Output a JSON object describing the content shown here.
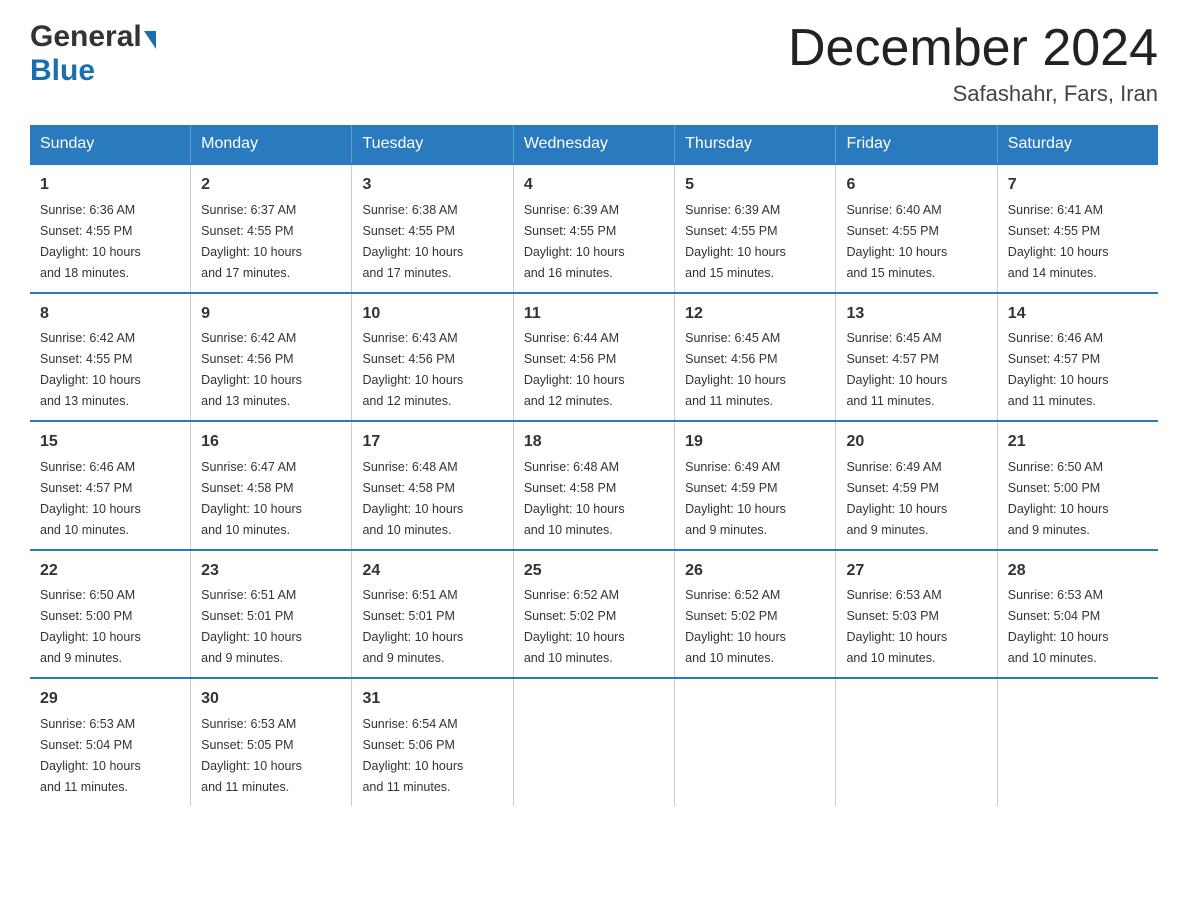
{
  "header": {
    "logo_general": "General",
    "logo_blue": "Blue",
    "month_title": "December 2024",
    "location": "Safashahr, Fars, Iran"
  },
  "weekdays": [
    "Sunday",
    "Monday",
    "Tuesday",
    "Wednesday",
    "Thursday",
    "Friday",
    "Saturday"
  ],
  "weeks": [
    [
      {
        "day": "1",
        "sunrise": "6:36 AM",
        "sunset": "4:55 PM",
        "daylight": "10 hours and 18 minutes."
      },
      {
        "day": "2",
        "sunrise": "6:37 AM",
        "sunset": "4:55 PM",
        "daylight": "10 hours and 17 minutes."
      },
      {
        "day": "3",
        "sunrise": "6:38 AM",
        "sunset": "4:55 PM",
        "daylight": "10 hours and 17 minutes."
      },
      {
        "day": "4",
        "sunrise": "6:39 AM",
        "sunset": "4:55 PM",
        "daylight": "10 hours and 16 minutes."
      },
      {
        "day": "5",
        "sunrise": "6:39 AM",
        "sunset": "4:55 PM",
        "daylight": "10 hours and 15 minutes."
      },
      {
        "day": "6",
        "sunrise": "6:40 AM",
        "sunset": "4:55 PM",
        "daylight": "10 hours and 15 minutes."
      },
      {
        "day": "7",
        "sunrise": "6:41 AM",
        "sunset": "4:55 PM",
        "daylight": "10 hours and 14 minutes."
      }
    ],
    [
      {
        "day": "8",
        "sunrise": "6:42 AM",
        "sunset": "4:55 PM",
        "daylight": "10 hours and 13 minutes."
      },
      {
        "day": "9",
        "sunrise": "6:42 AM",
        "sunset": "4:56 PM",
        "daylight": "10 hours and 13 minutes."
      },
      {
        "day": "10",
        "sunrise": "6:43 AM",
        "sunset": "4:56 PM",
        "daylight": "10 hours and 12 minutes."
      },
      {
        "day": "11",
        "sunrise": "6:44 AM",
        "sunset": "4:56 PM",
        "daylight": "10 hours and 12 minutes."
      },
      {
        "day": "12",
        "sunrise": "6:45 AM",
        "sunset": "4:56 PM",
        "daylight": "10 hours and 11 minutes."
      },
      {
        "day": "13",
        "sunrise": "6:45 AM",
        "sunset": "4:57 PM",
        "daylight": "10 hours and 11 minutes."
      },
      {
        "day": "14",
        "sunrise": "6:46 AM",
        "sunset": "4:57 PM",
        "daylight": "10 hours and 11 minutes."
      }
    ],
    [
      {
        "day": "15",
        "sunrise": "6:46 AM",
        "sunset": "4:57 PM",
        "daylight": "10 hours and 10 minutes."
      },
      {
        "day": "16",
        "sunrise": "6:47 AM",
        "sunset": "4:58 PM",
        "daylight": "10 hours and 10 minutes."
      },
      {
        "day": "17",
        "sunrise": "6:48 AM",
        "sunset": "4:58 PM",
        "daylight": "10 hours and 10 minutes."
      },
      {
        "day": "18",
        "sunrise": "6:48 AM",
        "sunset": "4:58 PM",
        "daylight": "10 hours and 10 minutes."
      },
      {
        "day": "19",
        "sunrise": "6:49 AM",
        "sunset": "4:59 PM",
        "daylight": "10 hours and 9 minutes."
      },
      {
        "day": "20",
        "sunrise": "6:49 AM",
        "sunset": "4:59 PM",
        "daylight": "10 hours and 9 minutes."
      },
      {
        "day": "21",
        "sunrise": "6:50 AM",
        "sunset": "5:00 PM",
        "daylight": "10 hours and 9 minutes."
      }
    ],
    [
      {
        "day": "22",
        "sunrise": "6:50 AM",
        "sunset": "5:00 PM",
        "daylight": "10 hours and 9 minutes."
      },
      {
        "day": "23",
        "sunrise": "6:51 AM",
        "sunset": "5:01 PM",
        "daylight": "10 hours and 9 minutes."
      },
      {
        "day": "24",
        "sunrise": "6:51 AM",
        "sunset": "5:01 PM",
        "daylight": "10 hours and 9 minutes."
      },
      {
        "day": "25",
        "sunrise": "6:52 AM",
        "sunset": "5:02 PM",
        "daylight": "10 hours and 10 minutes."
      },
      {
        "day": "26",
        "sunrise": "6:52 AM",
        "sunset": "5:02 PM",
        "daylight": "10 hours and 10 minutes."
      },
      {
        "day": "27",
        "sunrise": "6:53 AM",
        "sunset": "5:03 PM",
        "daylight": "10 hours and 10 minutes."
      },
      {
        "day": "28",
        "sunrise": "6:53 AM",
        "sunset": "5:04 PM",
        "daylight": "10 hours and 10 minutes."
      }
    ],
    [
      {
        "day": "29",
        "sunrise": "6:53 AM",
        "sunset": "5:04 PM",
        "daylight": "10 hours and 11 minutes."
      },
      {
        "day": "30",
        "sunrise": "6:53 AM",
        "sunset": "5:05 PM",
        "daylight": "10 hours and 11 minutes."
      },
      {
        "day": "31",
        "sunrise": "6:54 AM",
        "sunset": "5:06 PM",
        "daylight": "10 hours and 11 minutes."
      },
      null,
      null,
      null,
      null
    ]
  ],
  "labels": {
    "sunrise": "Sunrise:",
    "sunset": "Sunset:",
    "daylight": "Daylight:"
  }
}
